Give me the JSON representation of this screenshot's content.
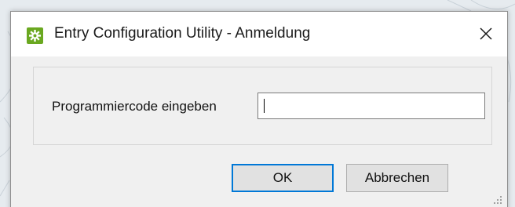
{
  "window": {
    "title": "Entry Configuration Utility - Anmeldung",
    "app_icon": "gear-icon",
    "close_icon": "close-icon"
  },
  "form": {
    "code_label": "Programmiercode eingeben",
    "code_value": ""
  },
  "buttons": {
    "ok_label": "OK",
    "cancel_label": "Abbrechen"
  },
  "colors": {
    "accent": "#0078d7",
    "icon_green": "#6aa820",
    "titlebar_bg": "#ffffff",
    "dialog_bg": "#f0f0f0"
  }
}
